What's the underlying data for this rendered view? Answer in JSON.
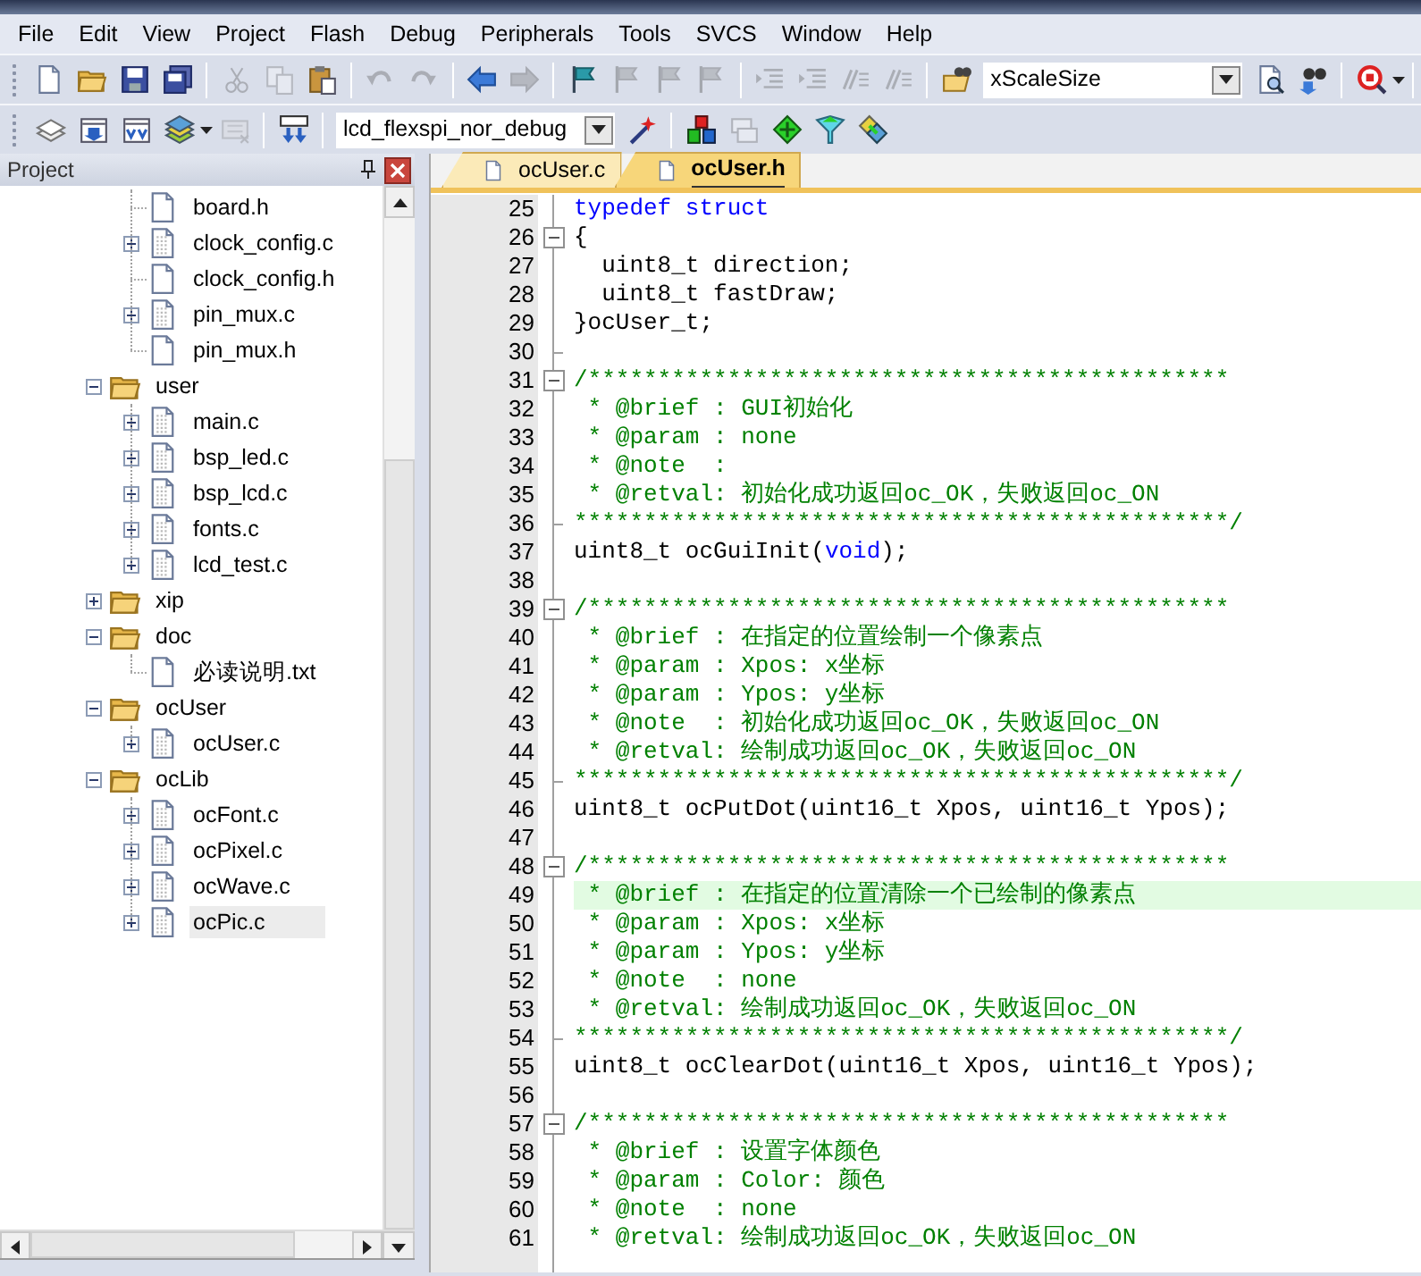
{
  "menu": [
    {
      "label": "File"
    },
    {
      "label": "Edit"
    },
    {
      "label": "View"
    },
    {
      "label": "Project"
    },
    {
      "label": "Flash"
    },
    {
      "label": "Debug"
    },
    {
      "label": "Peripherals"
    },
    {
      "label": "Tools"
    },
    {
      "label": "SVCS"
    },
    {
      "label": "Window"
    },
    {
      "label": "Help"
    }
  ],
  "toolbar_1": {
    "buttons": [
      {
        "disabled": false
      },
      {
        "disabled": false
      },
      {
        "disabled": false
      },
      {
        "disabled": false
      },
      {
        "disabled": true
      },
      {
        "disabled": true
      },
      {
        "disabled": false
      },
      {
        "disabled": true
      },
      {
        "disabled": true
      },
      {
        "disabled": false
      },
      {
        "disabled": true
      },
      {
        "disabled": false
      },
      {
        "disabled": true
      },
      {
        "disabled": true
      },
      {
        "disabled": true
      },
      {
        "disabled": true
      },
      {
        "disabled": true
      },
      {
        "disabled": true
      },
      {
        "disabled": true
      },
      {
        "disabled": false
      },
      {
        "disabled": false
      },
      {
        "disabled": false
      },
      {
        "disabled": false
      }
    ],
    "combo": {
      "value": "xScaleSize"
    }
  },
  "toolbar_2": {
    "buttons": [
      {
        "disabled": false
      },
      {
        "disabled": false
      },
      {
        "disabled": false
      },
      {
        "disabled": false
      },
      {
        "disabled": true
      },
      {
        "disabled": false
      },
      {
        "disabled": false
      },
      {
        "disabled": false
      },
      {
        "disabled": true
      },
      {
        "disabled": false
      },
      {
        "disabled": false
      },
      {
        "disabled": false
      }
    ],
    "combo": {
      "value": "lcd_flexspi_nor_debug"
    }
  },
  "project_panel": {
    "title": "Project",
    "tree": [
      {
        "children": [
          {
            "label": "board.h",
            "kind": "header",
            "selected": false
          },
          {
            "label": "clock_config.c",
            "kind": "source",
            "expanded": false,
            "selected": false
          },
          {
            "label": "clock_config.h",
            "kind": "header",
            "selected": false
          },
          {
            "label": "pin_mux.c",
            "kind": "source",
            "expanded": false,
            "selected": false
          },
          {
            "label": "pin_mux.h",
            "kind": "header",
            "selected": false
          }
        ]
      },
      {
        "label": "user",
        "kind": "folder",
        "expanded": true,
        "selected": false,
        "children": [
          {
            "label": "main.c",
            "kind": "source",
            "expanded": false,
            "selected": false
          },
          {
            "label": "bsp_led.c",
            "kind": "source",
            "expanded": false,
            "selected": false
          },
          {
            "label": "bsp_lcd.c",
            "kind": "source",
            "expanded": false,
            "selected": false
          },
          {
            "label": "fonts.c",
            "kind": "source",
            "expanded": false,
            "selected": false
          },
          {
            "label": "lcd_test.c",
            "kind": "source",
            "expanded": false,
            "selected": false
          }
        ]
      },
      {
        "label": "xip",
        "kind": "folder",
        "expanded": false,
        "selected": false
      },
      {
        "label": "doc",
        "kind": "folder",
        "expanded": true,
        "selected": false,
        "children": [
          {
            "label": "必读说明.txt",
            "kind": "header",
            "selected": false
          }
        ]
      },
      {
        "label": "ocUser",
        "kind": "folder",
        "expanded": true,
        "selected": false,
        "children": [
          {
            "label": "ocUser.c",
            "kind": "source",
            "expanded": false,
            "selected": false
          }
        ]
      },
      {
        "label": "ocLib",
        "kind": "folder",
        "expanded": true,
        "selected": false,
        "children": [
          {
            "label": "ocFont.c",
            "kind": "source",
            "expanded": false,
            "selected": false
          },
          {
            "label": "ocPixel.c",
            "kind": "source",
            "expanded": false,
            "selected": false
          },
          {
            "label": "ocWave.c",
            "kind": "source",
            "expanded": false,
            "selected": false
          },
          {
            "label": "ocPic.c",
            "kind": "source",
            "expanded": false,
            "selected": true
          }
        ]
      }
    ]
  },
  "editor": {
    "tabs": [
      {
        "label": "ocUser.c",
        "selected": false
      },
      {
        "label": "ocUser.h",
        "selected": true
      }
    ],
    "lines": [
      {
        "number": "25",
        "segments": [
          {
            "kind": "keyword",
            "text": "typedef struct"
          }
        ]
      },
      {
        "number": "26",
        "fold_start": true,
        "segments": [
          {
            "kind": "plain",
            "text": "{"
          }
        ]
      },
      {
        "number": "27",
        "segments": [
          {
            "kind": "plain",
            "text": "  uint8_t direction;"
          }
        ]
      },
      {
        "number": "28",
        "segments": [
          {
            "kind": "plain",
            "text": "  uint8_t fastDraw;"
          }
        ]
      },
      {
        "number": "29",
        "segments": [
          {
            "kind": "plain",
            "text": "}ocUser_t;"
          }
        ]
      },
      {
        "number": "30",
        "fold_end": true
      },
      {
        "number": "31",
        "fold_start": true,
        "segments": [
          {
            "kind": "comment",
            "text": "/**********************************************"
          }
        ]
      },
      {
        "number": "32",
        "segments": [
          {
            "kind": "comment",
            "text": " * @brief : GUI初始化"
          }
        ]
      },
      {
        "number": "33",
        "segments": [
          {
            "kind": "comment",
            "text": " * @param : none"
          }
        ]
      },
      {
        "number": "34",
        "segments": [
          {
            "kind": "comment",
            "text": " * @note  :"
          }
        ]
      },
      {
        "number": "35",
        "segments": [
          {
            "kind": "comment",
            "text": " * @retval: 初始化成功返回oc_OK，失败返回oc_ON"
          }
        ]
      },
      {
        "number": "36",
        "fold_end": true,
        "segments": [
          {
            "kind": "comment",
            "text": "***********************************************/"
          }
        ]
      },
      {
        "number": "37",
        "segments": [
          {
            "kind": "plain",
            "text": "uint8_t ocGuiInit("
          },
          {
            "kind": "keyword",
            "text": "void"
          },
          {
            "kind": "plain",
            "text": ");"
          }
        ]
      },
      {
        "number": "38"
      },
      {
        "number": "39",
        "fold_start": true,
        "segments": [
          {
            "kind": "comment",
            "text": "/**********************************************"
          }
        ]
      },
      {
        "number": "40",
        "segments": [
          {
            "kind": "comment",
            "text": " * @brief : 在指定的位置绘制一个像素点"
          }
        ]
      },
      {
        "number": "41",
        "segments": [
          {
            "kind": "comment",
            "text": " * @param : Xpos: x坐标"
          }
        ]
      },
      {
        "number": "42",
        "segments": [
          {
            "kind": "comment",
            "text": " * @param : Ypos: y坐标"
          }
        ]
      },
      {
        "number": "43",
        "segments": [
          {
            "kind": "comment",
            "text": " * @note  : 初始化成功返回oc_OK，失败返回oc_ON"
          }
        ]
      },
      {
        "number": "44",
        "segments": [
          {
            "kind": "comment",
            "text": " * @retval: 绘制成功返回oc_OK，失败返回oc_ON"
          }
        ]
      },
      {
        "number": "45",
        "fold_end": true,
        "segments": [
          {
            "kind": "comment",
            "text": "***********************************************/"
          }
        ]
      },
      {
        "number": "46",
        "segments": [
          {
            "kind": "plain",
            "text": "uint8_t ocPutDot(uint16_t Xpos, uint16_t Ypos);"
          }
        ]
      },
      {
        "number": "47"
      },
      {
        "number": "48",
        "fold_start": true,
        "segments": [
          {
            "kind": "comment",
            "text": "/**********************************************"
          }
        ]
      },
      {
        "number": "49",
        "highlighted": true,
        "segments": [
          {
            "kind": "comment",
            "text": " * @brief : 在指定的位置清除一个已绘制的像素点"
          }
        ]
      },
      {
        "number": "50",
        "segments": [
          {
            "kind": "comment",
            "text": " * @param : Xpos: x坐标"
          }
        ]
      },
      {
        "number": "51",
        "segments": [
          {
            "kind": "comment",
            "text": " * @param : Ypos: y坐标"
          }
        ]
      },
      {
        "number": "52",
        "segments": [
          {
            "kind": "comment",
            "text": " * @note  : none"
          }
        ]
      },
      {
        "number": "53",
        "segments": [
          {
            "kind": "comment",
            "text": " * @retval: 绘制成功返回oc_OK，失败返回oc_ON"
          }
        ]
      },
      {
        "number": "54",
        "fold_end": true,
        "segments": [
          {
            "kind": "comment",
            "text": "***********************************************/"
          }
        ]
      },
      {
        "number": "55",
        "segments": [
          {
            "kind": "plain",
            "text": "uint8_t ocClearDot(uint16_t Xpos, uint16_t Ypos);"
          }
        ]
      },
      {
        "number": "56"
      },
      {
        "number": "57",
        "fold_start": true,
        "segments": [
          {
            "kind": "comment",
            "text": "/**********************************************"
          }
        ]
      },
      {
        "number": "58",
        "segments": [
          {
            "kind": "comment",
            "text": " * @brief : 设置字体颜色"
          }
        ]
      },
      {
        "number": "59",
        "segments": [
          {
            "kind": "comment",
            "text": " * @param : Color: 颜色"
          }
        ]
      },
      {
        "number": "60",
        "segments": [
          {
            "kind": "comment",
            "text": " * @note  : none"
          }
        ]
      },
      {
        "number": "61",
        "segments": [
          {
            "kind": "comment",
            "text": " * @retval: 绘制成功返回oc_OK，失败返回oc_ON"
          }
        ]
      }
    ]
  }
}
